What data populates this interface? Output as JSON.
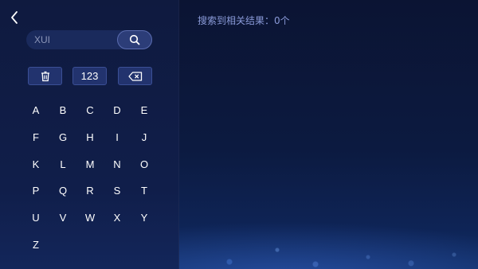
{
  "nav": {
    "back_icon": "chevron-left-icon"
  },
  "search": {
    "placeholder": "XUI",
    "value": "",
    "button_icon": "search-icon"
  },
  "function_keys": {
    "clear_icon": "trash-icon",
    "numbers_label": "123",
    "backspace_icon": "backspace-icon"
  },
  "keyboard": {
    "keys": [
      "A",
      "B",
      "C",
      "D",
      "E",
      "F",
      "G",
      "H",
      "I",
      "J",
      "K",
      "L",
      "M",
      "N",
      "O",
      "P",
      "Q",
      "R",
      "S",
      "T",
      "U",
      "V",
      "W",
      "X",
      "Y",
      "Z"
    ]
  },
  "results": {
    "label": "搜索到相关结果：0个"
  },
  "colors": {
    "background": "#0b1433",
    "panel": "#0f1a3f",
    "accent_text": "#8a9ad8",
    "button": "#22336e"
  }
}
